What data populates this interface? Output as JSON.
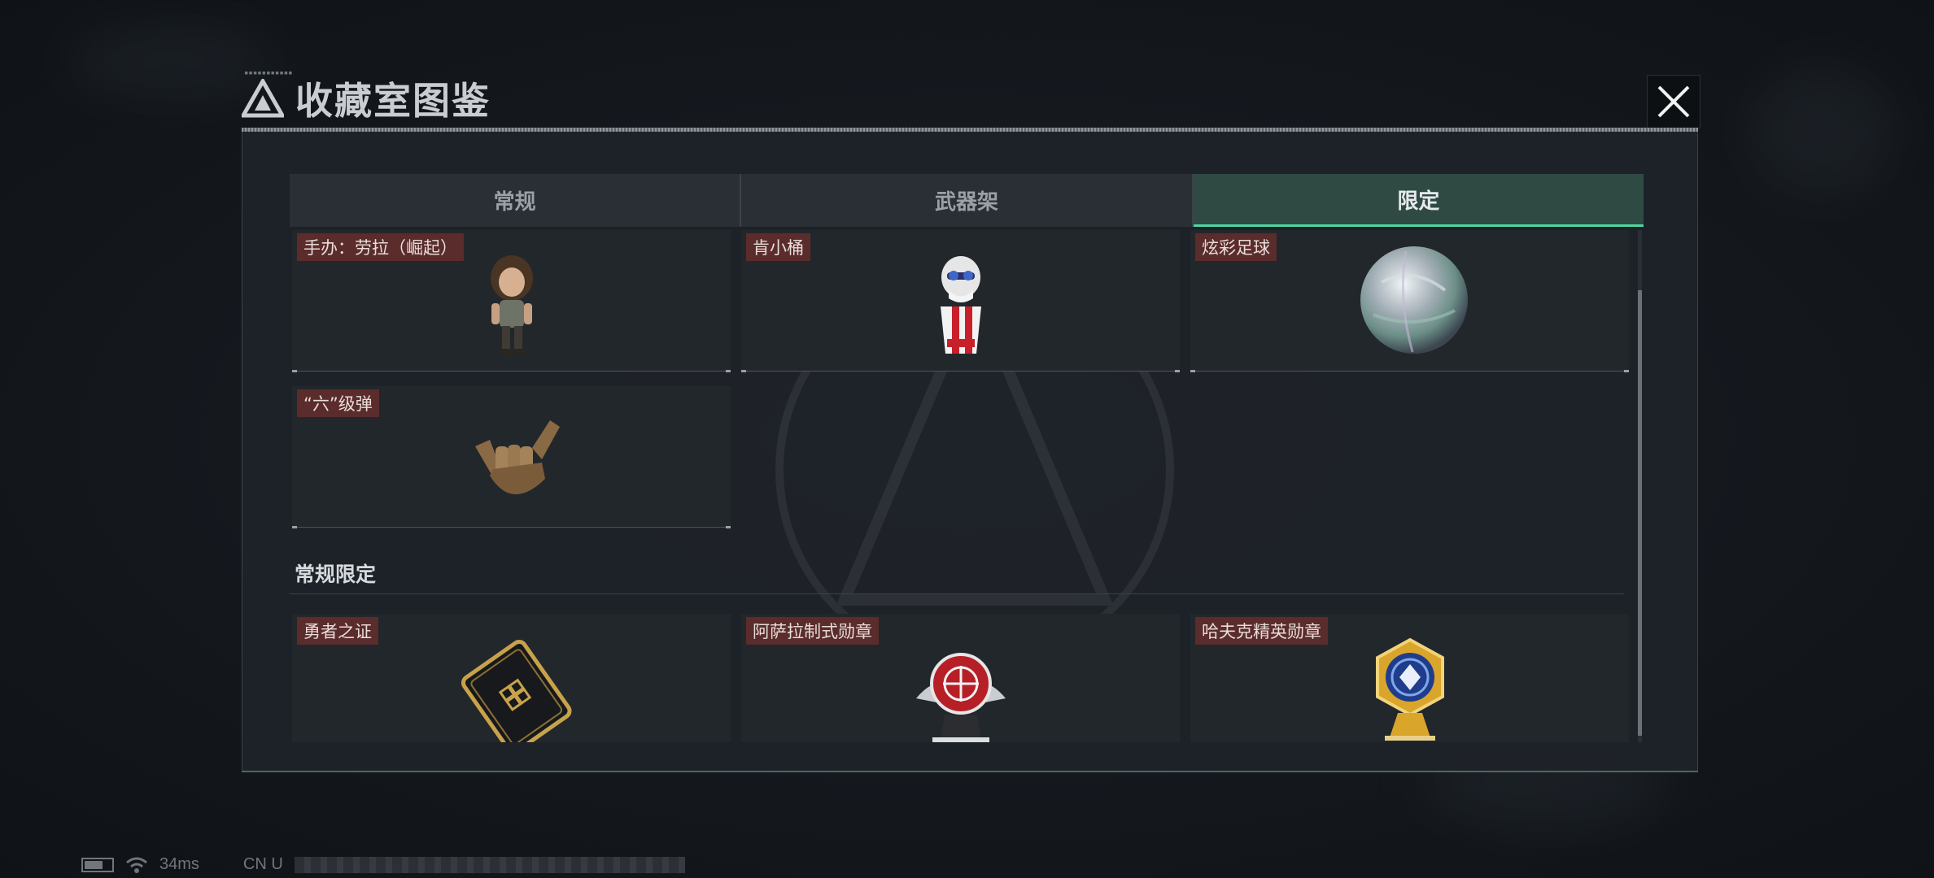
{
  "window": {
    "title": "收藏室图鉴",
    "close_icon": "close-icon"
  },
  "tabs": [
    {
      "label": "常规",
      "active": false
    },
    {
      "label": "武器架",
      "active": false
    },
    {
      "label": "限定",
      "active": true
    }
  ],
  "items_limited": [
    {
      "label": "手办：劳拉（崛起）",
      "icon": "lara-figure-icon"
    },
    {
      "label": "肯小桶",
      "icon": "kfc-bucket-figure-icon"
    },
    {
      "label": "炫彩足球",
      "icon": "iridescent-football-icon"
    },
    {
      "label": "“六”级弹",
      "icon": "shaka-hand-icon"
    }
  ],
  "section_regular_limited": {
    "heading": "常规限定",
    "items": [
      {
        "label": "勇者之证",
        "icon": "brave-card-icon"
      },
      {
        "label": "阿萨拉制式勋章",
        "icon": "asara-medal-icon"
      },
      {
        "label": "哈夫克精英勋章",
        "icon": "haavk-elite-medal-icon"
      }
    ]
  },
  "status_bar": {
    "latency": "34ms",
    "region": "CN U"
  },
  "colors": {
    "accent": "#4fd6a0",
    "active_tab_bg": "#2f4a43",
    "label_bg": "#5a2c2c"
  }
}
